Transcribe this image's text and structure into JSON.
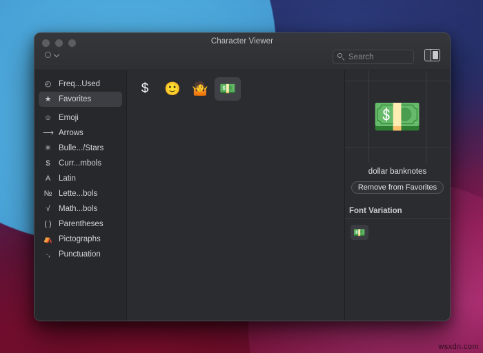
{
  "desktop": {
    "watermark": "wsxdn.com",
    "colors": {
      "blue": "#4ba6da",
      "navy": "#2a3d86",
      "crimson": "#800e2c",
      "magenta": "#c43c8c"
    }
  },
  "window": {
    "title": "Character Viewer",
    "traffic_lights": [
      "close",
      "minimize",
      "zoom"
    ],
    "toolbar": {
      "menu_icon": "gear-icon",
      "menu_chevron": "chevron-down-icon",
      "search_placeholder": "Search",
      "search_value": "",
      "search_icon": "search-icon",
      "panel_toggle_icon": "panel-layout-icon"
    }
  },
  "sidebar": {
    "items": [
      {
        "icon": "clock-icon",
        "glyph": "◴",
        "label": "Freq...Used",
        "selected": false
      },
      {
        "icon": "star-icon",
        "glyph": "★",
        "label": "Favorites",
        "selected": true
      },
      {
        "icon": "smiley-icon",
        "glyph": "☺",
        "label": "Emoji",
        "selected": false
      },
      {
        "icon": "arrow-right-icon",
        "glyph": "⟶",
        "label": "Arrows",
        "selected": false
      },
      {
        "icon": "asterisk-icon",
        "glyph": "✳",
        "label": "Bulle.../Stars",
        "selected": false
      },
      {
        "icon": "dollar-icon",
        "glyph": "$",
        "label": "Curr...mbols",
        "selected": false
      },
      {
        "icon": "latin-a-icon",
        "glyph": "A",
        "label": "Latin",
        "selected": false
      },
      {
        "icon": "numero-icon",
        "glyph": "№",
        "label": "Lette...bols",
        "selected": false
      },
      {
        "icon": "radical-icon",
        "glyph": "√",
        "label": "Math...bols",
        "selected": false
      },
      {
        "icon": "parentheses-icon",
        "glyph": "( )",
        "label": "Parentheses",
        "selected": false
      },
      {
        "icon": "pictograph-icon",
        "glyph": "⛺",
        "label": "Pictographs",
        "selected": false
      },
      {
        "icon": "punctuation-icon",
        "glyph": "·,",
        "label": "Punctuation",
        "selected": false
      }
    ]
  },
  "grid": {
    "characters": [
      {
        "glyph": "$",
        "name": "dollar-sign",
        "selected": false
      },
      {
        "glyph": "🙂",
        "name": "slightly-smiling-face",
        "selected": false
      },
      {
        "glyph": "🤷",
        "name": "person-shrugging",
        "selected": false
      },
      {
        "glyph": "💵",
        "name": "dollar-banknotes",
        "selected": true
      }
    ]
  },
  "preview": {
    "glyph": "💵",
    "character_name": "dollar banknotes",
    "favorite_button_label": "Remove from Favorites",
    "font_variation_title": "Font Variation",
    "variations": [
      {
        "glyph": "💵",
        "name": "dollar-banknotes-variation"
      }
    ]
  }
}
